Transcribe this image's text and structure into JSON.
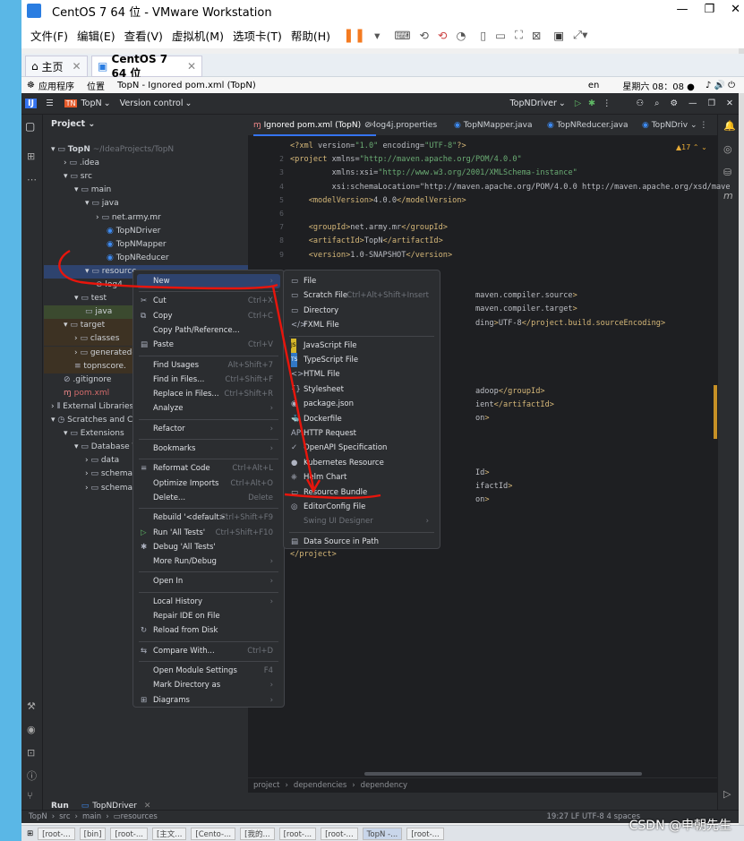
{
  "window": {
    "title": "CentOS 7 64 位 - VMware Workstation"
  },
  "vm_menu": [
    "文件(F)",
    "编辑(E)",
    "查看(V)",
    "虚拟机(M)",
    "选项卡(T)",
    "帮助(H)"
  ],
  "vm_tabs": {
    "home": "主页",
    "active": "CentOS 7 64 位"
  },
  "gnome": {
    "apps": "应用程序",
    "places": "位置",
    "window": "TopN - Ignored pom.xml (TopN)",
    "lang": "en",
    "clock": "星期六 08：08 ●"
  },
  "ide": {
    "project_badge": "TN",
    "project_name": "TopN",
    "vcs": "Version control",
    "run_config": "TopNDriver",
    "panel_title": "Project",
    "tree": [
      {
        "label": "TopN",
        "extra": "~/IdeaProjects/TopN"
      },
      {
        "label": ".idea"
      },
      {
        "label": "src"
      },
      {
        "label": "main"
      },
      {
        "label": "java"
      },
      {
        "label": "net.army.mr"
      },
      {
        "label": "TopNDriver"
      },
      {
        "label": "TopNMapper"
      },
      {
        "label": "TopNReducer"
      },
      {
        "label": "resource"
      },
      {
        "label": "log4"
      },
      {
        "label": "test"
      },
      {
        "label": "java"
      },
      {
        "label": "target"
      },
      {
        "label": "classes"
      },
      {
        "label": "generated-"
      },
      {
        "label": "topnscore."
      },
      {
        "label": ".gitignore"
      },
      {
        "label": "pom.xml"
      },
      {
        "label": "External Libraries"
      },
      {
        "label": "Scratches and Co"
      },
      {
        "label": "Extensions"
      },
      {
        "label": "Database T"
      },
      {
        "label": "data"
      },
      {
        "label": "schema"
      },
      {
        "label": "schema"
      }
    ],
    "editor_tabs": [
      "Ignored pom.xml (TopN)",
      "log4j.properties",
      "TopNMapper.java",
      "TopNReducer.java",
      "TopNDriv"
    ],
    "warnings": "▲17",
    "code_lines": [
      {
        "n": "",
        "t": "<?xml version=\"1.0\" encoding=\"UTF-8\"?>"
      },
      {
        "n": "2",
        "t": "<project xmlns=\"http://maven.apache.org/POM/4.0.0\""
      },
      {
        "n": "3",
        "t": "         xmlns:xsi=\"http://www.w3.org/2001/XMLSchema-instance\""
      },
      {
        "n": "4",
        "t": "         xsi:schemaLocation=\"http://maven.apache.org/POM/4.0.0 http://maven.apache.org/xsd/mave"
      },
      {
        "n": "5",
        "t": "    <modelVersion>4.0.0</modelVersion>"
      },
      {
        "n": "6",
        "t": ""
      },
      {
        "n": "7",
        "t": "    <groupId>net.army.mr</groupId>"
      },
      {
        "n": "8",
        "t": "    <artifactId>TopN</artifactId>"
      },
      {
        "n": "9",
        "t": "    <version>1.0-SNAPSHOT</version>"
      },
      {
        "n": "",
        "t": ""
      },
      {
        "n": "",
        "t": ""
      },
      {
        "n": "",
        "t": "                                        maven.compiler.source>"
      },
      {
        "n": "",
        "t": "                                        maven.compiler.target>"
      },
      {
        "n": "",
        "t": "                                        ding>UTF-8</project.build.sourceEncoding>"
      },
      {
        "n": "",
        "t": ""
      },
      {
        "n": "",
        "t": ""
      },
      {
        "n": "",
        "t": ""
      },
      {
        "n": "",
        "t": ""
      },
      {
        "n": "",
        "t": "                                        adoop</groupId>"
      },
      {
        "n": "",
        "t": "                                        ient</artifactId>"
      },
      {
        "n": "",
        "t": "                                        on>"
      },
      {
        "n": "",
        "t": ""
      },
      {
        "n": "",
        "t": ""
      },
      {
        "n": "",
        "t": ""
      },
      {
        "n": "",
        "t": "                                        Id>"
      },
      {
        "n": "",
        "t": "                                        ifactId>"
      },
      {
        "n": "",
        "t": "                                        on>"
      },
      {
        "n": "",
        "t": ""
      },
      {
        "n": "",
        "t": ""
      },
      {
        "n": "",
        "t": ""
      },
      {
        "n": "",
        "t": "</project>"
      }
    ],
    "breadcrumbs": [
      "project",
      "dependencies",
      "dependency"
    ],
    "run_tab": "Run",
    "run_config_tab": "TopNDriver",
    "status_path": [
      "TopN",
      "src",
      "main",
      "resources"
    ],
    "status_right": "19:27  LF  UTF-8  4 spaces"
  },
  "context_menu": [
    {
      "label": "New",
      "sc": "",
      "arrow": true,
      "hl": true
    },
    {
      "sep": true
    },
    {
      "label": "Cut",
      "sc": "Ctrl+X",
      "icon": "✂"
    },
    {
      "label": "Copy",
      "sc": "Ctrl+C",
      "icon": "⧉"
    },
    {
      "label": "Copy Path/Reference...",
      "sc": ""
    },
    {
      "label": "Paste",
      "sc": "Ctrl+V",
      "icon": "▤"
    },
    {
      "sep": true
    },
    {
      "label": "Find Usages",
      "sc": "Alt+Shift+7"
    },
    {
      "label": "Find in Files...",
      "sc": "Ctrl+Shift+F"
    },
    {
      "label": "Replace in Files...",
      "sc": "Ctrl+Shift+R"
    },
    {
      "label": "Analyze",
      "sc": "",
      "arrow": true
    },
    {
      "sep": true
    },
    {
      "label": "Refactor",
      "sc": "",
      "arrow": true
    },
    {
      "sep": true
    },
    {
      "label": "Bookmarks",
      "sc": "",
      "arrow": true
    },
    {
      "sep": true
    },
    {
      "label": "Reformat Code",
      "sc": "Ctrl+Alt+L",
      "icon": "≡"
    },
    {
      "label": "Optimize Imports",
      "sc": "Ctrl+Alt+O"
    },
    {
      "label": "Delete...",
      "sc": "Delete"
    },
    {
      "sep": true
    },
    {
      "label": "Rebuild '<default>'",
      "sc": "Ctrl+Shift+F9"
    },
    {
      "label": "Run 'All Tests'",
      "sc": "Ctrl+Shift+F10",
      "icon": "▷"
    },
    {
      "label": "Debug 'All Tests'",
      "sc": "",
      "icon": "✱"
    },
    {
      "label": "More Run/Debug",
      "sc": "",
      "arrow": true
    },
    {
      "sep": true
    },
    {
      "label": "Open In",
      "sc": "",
      "arrow": true
    },
    {
      "sep": true
    },
    {
      "label": "Local History",
      "sc": "",
      "arrow": true
    },
    {
      "label": "Repair IDE on File",
      "sc": ""
    },
    {
      "label": "Reload from Disk",
      "sc": "",
      "icon": "↻"
    },
    {
      "sep": true
    },
    {
      "label": "Compare With...",
      "sc": "Ctrl+D",
      "icon": "⇆"
    },
    {
      "sep": true
    },
    {
      "label": "Open Module Settings",
      "sc": "F4"
    },
    {
      "label": "Mark Directory as",
      "sc": "",
      "arrow": true
    },
    {
      "label": "Diagrams",
      "sc": "",
      "arrow": true,
      "icon": "⊞"
    }
  ],
  "submenu": [
    {
      "label": "File",
      "sc": "",
      "icon": "▭"
    },
    {
      "label": "Scratch File",
      "sc": "Ctrl+Alt+Shift+Insert",
      "icon": "▭"
    },
    {
      "label": "Directory",
      "sc": "",
      "icon": "▭"
    },
    {
      "label": "FXML File",
      "sc": "",
      "icon": "</>"
    },
    {
      "sep": true
    },
    {
      "label": "JavaScript File",
      "sc": "",
      "icon": "JS"
    },
    {
      "label": "TypeScript File",
      "sc": "",
      "icon": "TS"
    },
    {
      "label": "HTML File",
      "sc": "",
      "icon": "<>"
    },
    {
      "label": "Stylesheet",
      "sc": "",
      "icon": "{}"
    },
    {
      "label": "package.json",
      "sc": "",
      "icon": "◉"
    },
    {
      "label": "Dockerfile",
      "sc": "",
      "icon": "🐳"
    },
    {
      "label": "HTTP Request",
      "sc": "",
      "icon": "API"
    },
    {
      "label": "OpenAPI Specification",
      "sc": "",
      "icon": "✓"
    },
    {
      "label": "Kubernetes Resource",
      "sc": "",
      "icon": "●"
    },
    {
      "label": "Helm Chart",
      "sc": "",
      "icon": "⎈"
    },
    {
      "label": "Resource Bundle",
      "sc": "",
      "icon": "▭"
    },
    {
      "label": "EditorConfig File",
      "sc": "",
      "icon": "◎"
    },
    {
      "label": "Swing UI Designer",
      "sc": "",
      "dis": true,
      "arrow": true
    },
    {
      "sep": true
    },
    {
      "label": "Data Source in Path",
      "sc": "",
      "icon": "▤"
    }
  ],
  "taskbar": [
    "[root-...",
    "[bin]",
    "[root-...",
    "[主文...",
    "[Cento-...",
    "[我的...",
    "[root-...",
    "[root-...",
    "TopN -...",
    "[root-..."
  ],
  "watermark": "CSDN @申朝先生",
  "colors": {
    "accent": "#3574f0",
    "annotation": "#e8150c",
    "ide_bg": "#2b2d30",
    "editor_bg": "#1e1f22"
  }
}
